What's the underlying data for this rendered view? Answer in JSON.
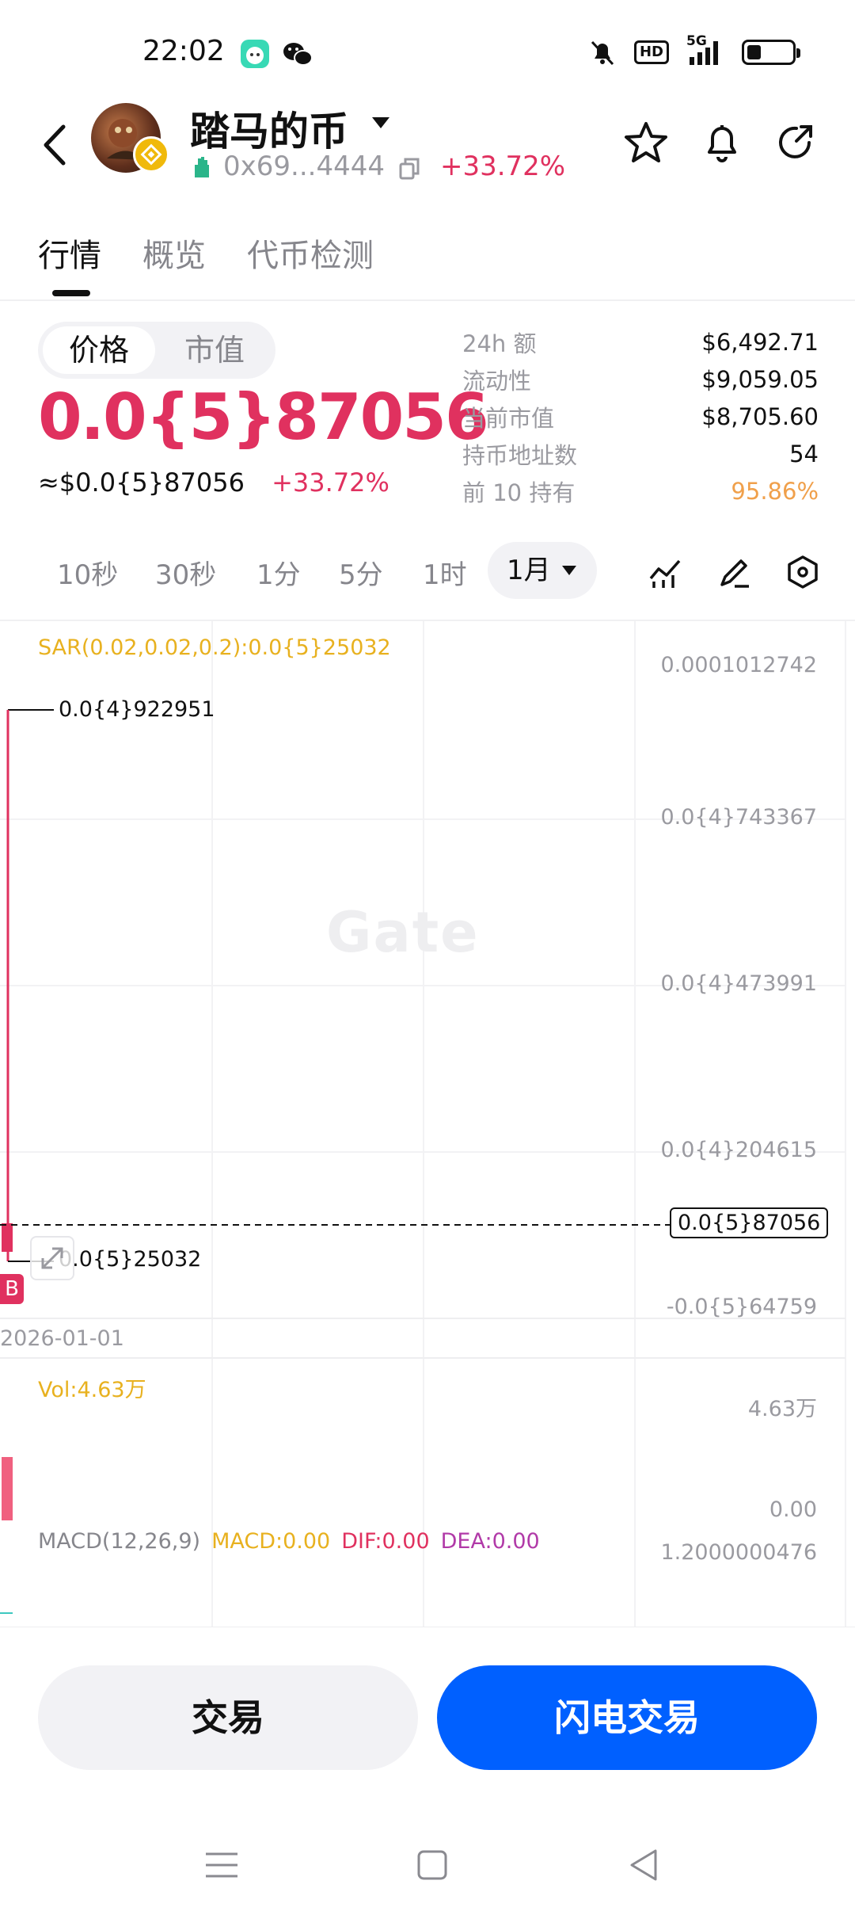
{
  "status_bar": {
    "time": "22:02",
    "network": "5G",
    "hd": "HD",
    "battery_level": 0.3,
    "icons": [
      "app-notification-icon",
      "wechat-icon",
      "mute-bell-icon",
      "hd-icon",
      "signal-icon",
      "battery-icon"
    ]
  },
  "header": {
    "token_name": "踏马的币",
    "address": "0x69...4444",
    "change": "+33.72%",
    "icons": [
      "back-icon",
      "star-icon",
      "bell-icon",
      "share-icon"
    ]
  },
  "tabs": [
    {
      "label": "行情",
      "active": true
    },
    {
      "label": "概览",
      "active": false
    },
    {
      "label": "代币检测",
      "active": false
    }
  ],
  "price_panel": {
    "toggle": [
      "价格",
      "市值"
    ],
    "price": "0.0{5}87056",
    "approx": "≈$0.0{5}87056",
    "change": "+33.72%"
  },
  "stats": [
    {
      "label": "24h  额",
      "value": "$6,492.71"
    },
    {
      "label": "流动性",
      "value": "$9,059.05"
    },
    {
      "label": "当前市值",
      "value": "$8,705.60"
    },
    {
      "label": "持币地址数",
      "value": "54"
    },
    {
      "label": "前 10 持有",
      "value": "95.86%",
      "color": "#f0a04b"
    }
  ],
  "intervals": {
    "options": [
      "10秒",
      "30秒",
      "1分",
      "5分",
      "1时"
    ],
    "selected": "1月"
  },
  "chart": {
    "watermark": "Gate",
    "sar_label": "SAR(0.02,0.02,0.2):0.0{5}25032",
    "y_axis": [
      "0.0001012742",
      "0.0{4}743367",
      "0.0{4}473991",
      "0.0{4}204615",
      "-0.0{5}64759"
    ],
    "current_price": "0.0{5}87056",
    "high_label": "0.0{4}922951",
    "low_label": "0.0{5}25032",
    "date_label": "2026-01-01",
    "buy_marker": "B",
    "vol_label": "Vol:4.63万",
    "vol_axis": [
      "4.63万",
      "0.00"
    ],
    "macd_title": "MACD(12,26,9)",
    "macd_value": "MACD:0.00",
    "dif_value": "DIF:0.00",
    "dea_value": "DEA:0.00",
    "macd_axis": "1.2000000476",
    "colors": {
      "up": "#e0315f",
      "sar": "#e8b11f",
      "dea": "#b13aa8"
    }
  },
  "actions": {
    "trade": "交易",
    "flash_trade": "闪电交易",
    "flash_color": "#0060ff"
  },
  "nav": [
    "menu-icon",
    "home-square-icon",
    "back-triangle-icon"
  ]
}
